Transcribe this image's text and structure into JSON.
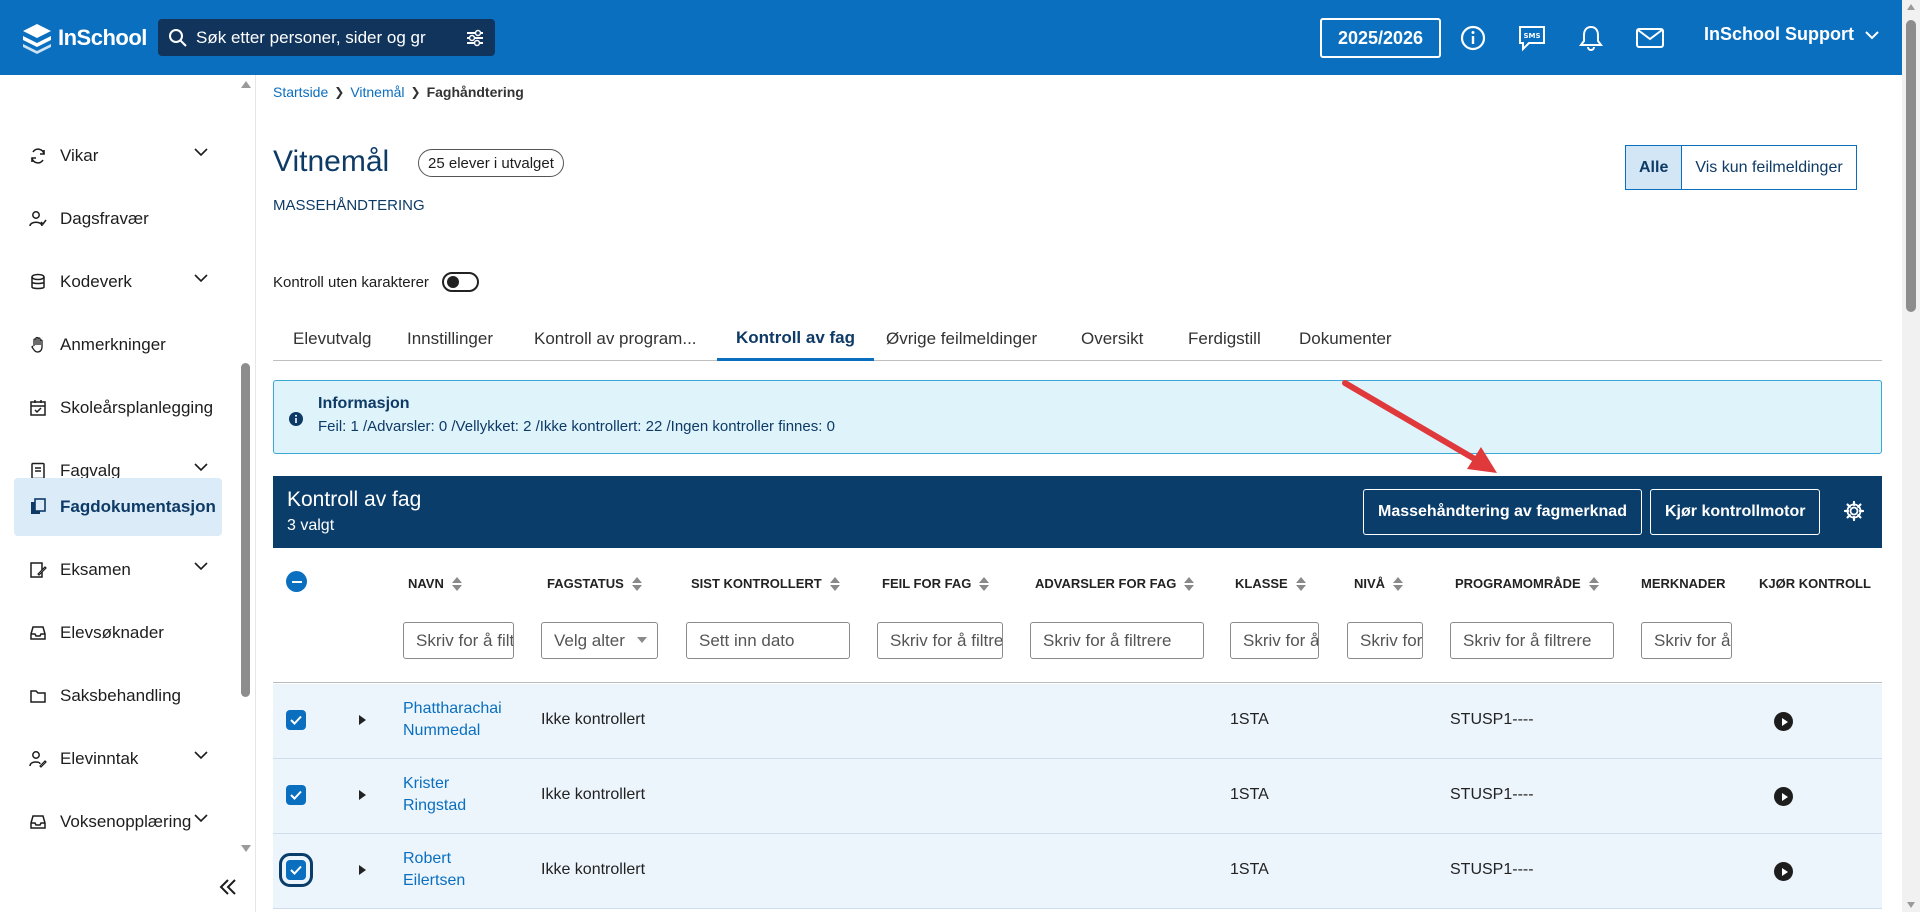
{
  "app": {
    "name": "InSchool"
  },
  "search": {
    "placeholder": "Søk etter personer, sider og grupper"
  },
  "header": {
    "school_year": "2025/2026",
    "user": "InSchool Support"
  },
  "sidebar": {
    "items": [
      {
        "label": "Vikar",
        "icon": "refresh-icon",
        "expandable": true
      },
      {
        "label": "Dagsfravær",
        "icon": "person-check-icon",
        "expandable": false
      },
      {
        "label": "Kodeverk",
        "icon": "database-icon",
        "expandable": true
      },
      {
        "label": "Anmerkninger",
        "icon": "hand-icon",
        "expandable": false
      },
      {
        "label": "Skoleårsplanlegging",
        "icon": "calendar-check-icon",
        "expandable": false
      },
      {
        "label": "Fagvalg",
        "icon": "document-icon",
        "expandable": true
      },
      {
        "label": "Fagdokumentasjon",
        "icon": "documents-icon",
        "expandable": false,
        "active": true
      },
      {
        "label": "Eksamen",
        "icon": "edit-document-icon",
        "expandable": true
      },
      {
        "label": "Elevsøknader",
        "icon": "inbox-icon",
        "expandable": false
      },
      {
        "label": "Saksbehandling",
        "icon": "folder-icon",
        "expandable": false
      },
      {
        "label": "Elevinntak",
        "icon": "person-edit-icon",
        "expandable": true
      },
      {
        "label": "Voksenopplæring",
        "icon": "inbox-icon",
        "expandable": true
      }
    ]
  },
  "breadcrumb": {
    "home": "Startside",
    "parent": "Vitnemål",
    "current": "Faghåndtering"
  },
  "page": {
    "title": "Vitnemål",
    "badge": "25 elever i utvalget",
    "subtitle": "MASSEHÅNDTERING",
    "filter_all": "Alle",
    "filter_errors": "Vis kun feilmeldinger",
    "toggle_label": "Kontroll uten karakterer"
  },
  "tabs": [
    {
      "label": "Elevutvalg"
    },
    {
      "label": "Innstillinger"
    },
    {
      "label": "Kontroll av program..."
    },
    {
      "label": "Kontroll av fag",
      "active": true
    },
    {
      "label": "Øvrige feilmeldinger"
    },
    {
      "label": "Oversikt"
    },
    {
      "label": "Ferdigstill"
    },
    {
      "label": "Dokumenter"
    }
  ],
  "info": {
    "title": "Informasjon",
    "text": "Feil: 1 /Advarsler: 0 /Vellykket: 2 /Ikke kontrollert: 22 /Ingen kontroller finnes: 0"
  },
  "table": {
    "title": "Kontroll av fag",
    "selected": "3 valgt",
    "btn_mass": "Massehåndtering av fagmerknad",
    "btn_run": "Kjør kontrollmotor",
    "columns": {
      "navn": "NAVN",
      "fagstatus": "FAGSTATUS",
      "sist": "SIST KONTROLLERT",
      "feil": "FEIL FOR FAG",
      "advarsler": "ADVARSLER FOR FAG",
      "klasse": "KLASSE",
      "niva": "NIVÅ",
      "program": "PROGRAMOMRÅDE",
      "merknader": "MERKNADER",
      "kjor": "KJØR KONTROLL"
    },
    "filters": {
      "navn": "Skriv for å filtrere",
      "fagstatus": "Velg alternativ",
      "sist": "Sett inn dato",
      "feil": "Skriv for å filtrere",
      "advarsler": "Skriv for å filtrere",
      "klasse": "Skriv for å filtrere",
      "niva": "Skriv for å filtrere",
      "program": "Skriv for å filtrere",
      "merknader": "Skriv for å filtrere"
    },
    "rows": [
      {
        "first": "Phattharachai",
        "last": "Nummedal",
        "status": "Ikke kontrollert",
        "klasse": "1STA",
        "program": "STUSP1----"
      },
      {
        "first": "Krister",
        "last": "Ringstad",
        "status": "Ikke kontrollert",
        "klasse": "1STA",
        "program": "STUSP1----"
      },
      {
        "first": "Robert",
        "last": "Eilertsen",
        "status": "Ikke kontrollert",
        "klasse": "1STA",
        "program": "STUSP1----"
      }
    ]
  },
  "colors": {
    "brand": "#0a6fbf",
    "table_header": "#0b3d6b",
    "annotation_arrow": "#e0393b"
  }
}
